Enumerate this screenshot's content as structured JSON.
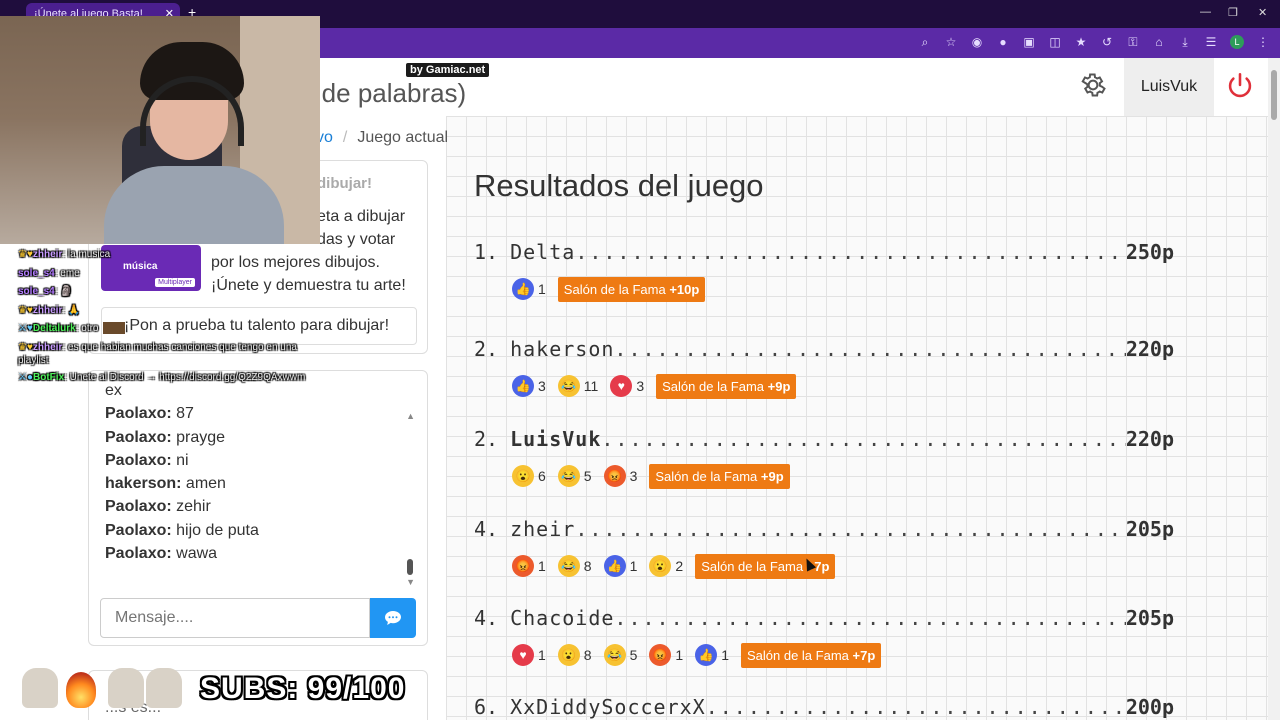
{
  "browser": {
    "tab_title": "¡Únete al juego Basta!",
    "tab_close": "✕",
    "new_tab": "+",
    "window_controls": [
      "—",
      "❐",
      "✕"
    ]
  },
  "header": {
    "site_title": "o de palabras)",
    "username": "LuisVuk"
  },
  "breadcrumb": {
    "link": "vo",
    "current": "Juego actual"
  },
  "overlay": {
    "gamiac": "by Gamiac.net",
    "subs": "SUBS: 99/100",
    "chat": [
      {
        "name": "zhheir",
        "text": " la musica"
      },
      {
        "name": "sole_s4",
        "text": " eme"
      },
      {
        "name": "sole_s4",
        "text": " 🗿"
      },
      {
        "name": "zhheir",
        "text": " 🙏"
      },
      {
        "name": "Deltalurk",
        "text": " otro"
      },
      {
        "name": "zhheir",
        "text": " es que habian muchas canciones que tengo en una playlist"
      },
      {
        "name": "BotFix",
        "text": " Unete al Discord → https://discord.gg/Q2Z9QAxwwm"
      }
    ]
  },
  "promo": {
    "heading": "dibujar!",
    "body": "eta a dibujar\ndas y votar\npor los mejores dibujos.\n¡Únete y demuestra tu arte!",
    "thumb_label": "música",
    "thumb_badge": "Multiplayer",
    "try_button": "¡Pon a prueba tu talento para dibujar!"
  },
  "chat": {
    "partial_top": "ex",
    "messages": [
      {
        "user": "Paolaxo:",
        "text": " 87"
      },
      {
        "user": "Paolaxo:",
        "text": " prayge"
      },
      {
        "user": "Paolaxo:",
        "text": " ni"
      },
      {
        "user": "hakerson:",
        "text": " amen"
      },
      {
        "user": "Paolaxo:",
        "text": " zehir"
      },
      {
        "user": "Paolaxo:",
        "text": " hijo de puta"
      },
      {
        "user": "Paolaxo:",
        "text": " wawa"
      }
    ],
    "input_placeholder": "Mensaje....",
    "bottom_card_text": "...s es..."
  },
  "results": {
    "title": "Resultados del juego",
    "rows": [
      {
        "rank": "1.",
        "name": "Delta",
        "points": "250p",
        "bold": false,
        "reactions": [
          {
            "icon": "like",
            "count": "1"
          }
        ],
        "fame_label": "Salón de la Fama",
        "fame_bonus": "+10p"
      },
      {
        "rank": "2.",
        "name": "hakerson",
        "points": "220p",
        "bold": false,
        "reactions": [
          {
            "icon": "like",
            "count": "3"
          },
          {
            "icon": "laugh",
            "count": "11"
          },
          {
            "icon": "love",
            "count": "3"
          }
        ],
        "fame_label": "Salón de la Fama",
        "fame_bonus": "+9p"
      },
      {
        "rank": "2.",
        "name": "LuisVuk",
        "points": "220p",
        "bold": true,
        "reactions": [
          {
            "icon": "wow",
            "count": "6"
          },
          {
            "icon": "laugh",
            "count": "5"
          },
          {
            "icon": "angry",
            "count": "3"
          }
        ],
        "fame_label": "Salón de la Fama",
        "fame_bonus": "+9p"
      },
      {
        "rank": "4.",
        "name": "zheir",
        "points": "205p",
        "bold": false,
        "reactions": [
          {
            "icon": "angry",
            "count": "1"
          },
          {
            "icon": "laugh",
            "count": "8"
          },
          {
            "icon": "like",
            "count": "1"
          },
          {
            "icon": "wow",
            "count": "2"
          }
        ],
        "fame_label": "Salón de la Fama",
        "fame_bonus": "+7p"
      },
      {
        "rank": "4.",
        "name": "Chacoide",
        "points": "205p",
        "bold": false,
        "reactions": [
          {
            "icon": "love",
            "count": "1"
          },
          {
            "icon": "wow",
            "count": "8"
          },
          {
            "icon": "laugh",
            "count": "5"
          },
          {
            "icon": "angry",
            "count": "1"
          },
          {
            "icon": "like",
            "count": "1"
          }
        ],
        "fame_label": "Salón de la Fama",
        "fame_bonus": "+7p"
      },
      {
        "rank": "6.",
        "name": "XxDiddySoccerxX",
        "points": "200p",
        "bold": false,
        "reactions": [],
        "fame_label": "",
        "fame_bonus": ""
      }
    ]
  },
  "colors": {
    "accent": "#2196f3",
    "fame": "#ee7a13",
    "power": "#e0303a",
    "browser_purple": "#5b2aa6"
  }
}
